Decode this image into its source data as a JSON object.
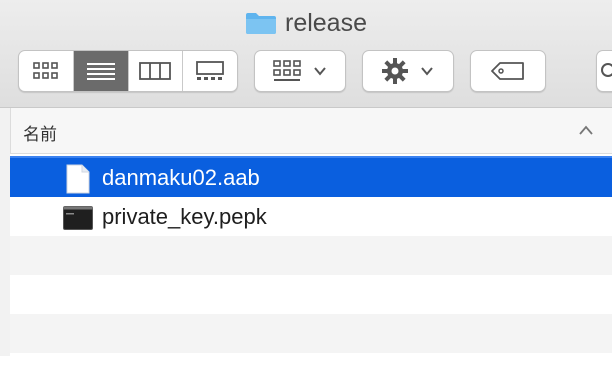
{
  "window": {
    "title": "release"
  },
  "toolbar": {
    "view_modes": [
      "icon-view",
      "list-view",
      "column-view",
      "gallery-view"
    ],
    "active_view": "list-view",
    "group_button_icon": "group-by-icon",
    "action_button_icon": "gear-icon",
    "tag_button_icon": "tag-icon"
  },
  "list": {
    "column_header": "名前",
    "sort_direction": "ascending",
    "files": [
      {
        "name": "danmaku02.aab",
        "icon": "document-icon",
        "selected": true
      },
      {
        "name": "private_key.pepk",
        "icon": "terminal-file-icon",
        "selected": false
      }
    ]
  },
  "colors": {
    "selection": "#0a5fdf",
    "folder": "#5fb4ee"
  }
}
